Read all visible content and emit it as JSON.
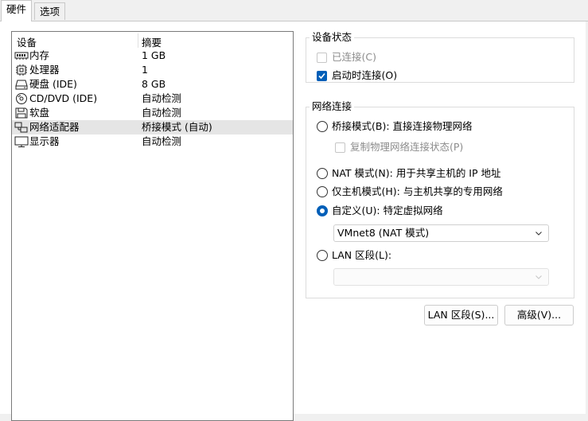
{
  "tabs": [
    {
      "label": "硬件",
      "active": true
    },
    {
      "label": "选项",
      "active": false
    }
  ],
  "device_list": {
    "headers": {
      "device": "设备",
      "summary": "摘要"
    },
    "rows": [
      {
        "icon": "memory-icon",
        "name": "内存",
        "summary": "1 GB",
        "selected": false
      },
      {
        "icon": "processor-icon",
        "name": "处理器",
        "summary": "1",
        "selected": false
      },
      {
        "icon": "hard-disk-icon",
        "name": "硬盘 (IDE)",
        "summary": "8 GB",
        "selected": false
      },
      {
        "icon": "cd-dvd-icon",
        "name": "CD/DVD (IDE)",
        "summary": "自动检测",
        "selected": false
      },
      {
        "icon": "floppy-icon",
        "name": "软盘",
        "summary": "自动检测",
        "selected": false
      },
      {
        "icon": "network-adapter-icon",
        "name": "网络适配器",
        "summary": "桥接模式 (自动)",
        "selected": true
      },
      {
        "icon": "display-icon",
        "name": "显示器",
        "summary": "自动检测",
        "selected": false
      }
    ]
  },
  "device_status": {
    "title": "设备状态",
    "connected": {
      "label": "已连接(C)",
      "checked": false,
      "enabled": false
    },
    "connect_at_power_on": {
      "label": "启动时连接(O)",
      "checked": true,
      "enabled": true
    }
  },
  "network_connection": {
    "title": "网络连接",
    "bridged": {
      "label": "桥接模式(B): 直接连接物理网络",
      "checked": false
    },
    "replicate_state": {
      "label": "复制物理网络连接状态(P)",
      "checked": false,
      "enabled": false
    },
    "nat": {
      "label": "NAT 模式(N): 用于共享主机的 IP 地址",
      "checked": false
    },
    "host_only": {
      "label": "仅主机模式(H): 与主机共享的专用网络",
      "checked": false
    },
    "custom": {
      "label": "自定义(U): 特定虚拟网络",
      "checked": true
    },
    "custom_select_value": "VMnet8 (NAT 模式)",
    "lan_segment": {
      "label": "LAN 区段(L):",
      "checked": false
    },
    "lan_select_value": ""
  },
  "buttons": {
    "lan_segments": "LAN 区段(S)...",
    "advanced": "高级(V)..."
  },
  "colors": {
    "accent": "#005fb8",
    "selected_row": "#e5e5e5"
  }
}
